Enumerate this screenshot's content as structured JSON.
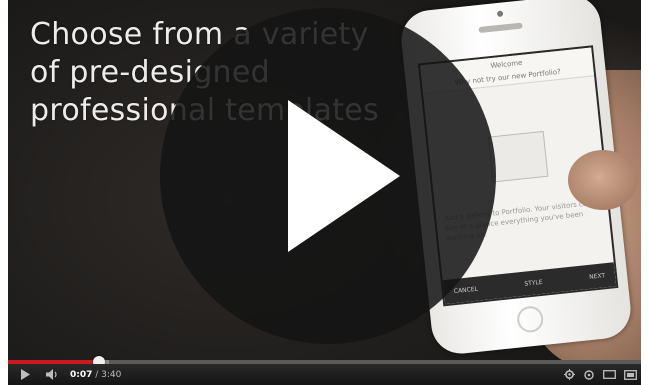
{
  "video": {
    "overlay_lines": [
      "Choose from a variety",
      "of pre-designed",
      "professional templates"
    ],
    "phone_screen": {
      "header_title": "Welcome",
      "header_subtitle": "Why not try our new Portfolio?",
      "body_text": "Add a gallery to Portfolio. Your visitors can see at a glance everything you've been working on.",
      "tab_left": "CANCEL",
      "tab_middle": "STYLE",
      "tab_right": "NEXT"
    }
  },
  "player": {
    "progress_played_fraction": 0.143,
    "progress_loaded_fraction": 0.16,
    "time_current": "0:07",
    "time_separator": " / ",
    "time_total": "3:40",
    "colors": {
      "played": "#cc181e",
      "track": "#5a5a5a",
      "loaded": "#8a8a8a",
      "play_button_bg": "#141414"
    },
    "icons": {
      "play": "play-icon",
      "big_play": "big-play-icon",
      "volume": "volume-icon",
      "settings": "gear-icon",
      "captions": "captions-icon",
      "fullscreen": "fullscreen-icon"
    }
  }
}
